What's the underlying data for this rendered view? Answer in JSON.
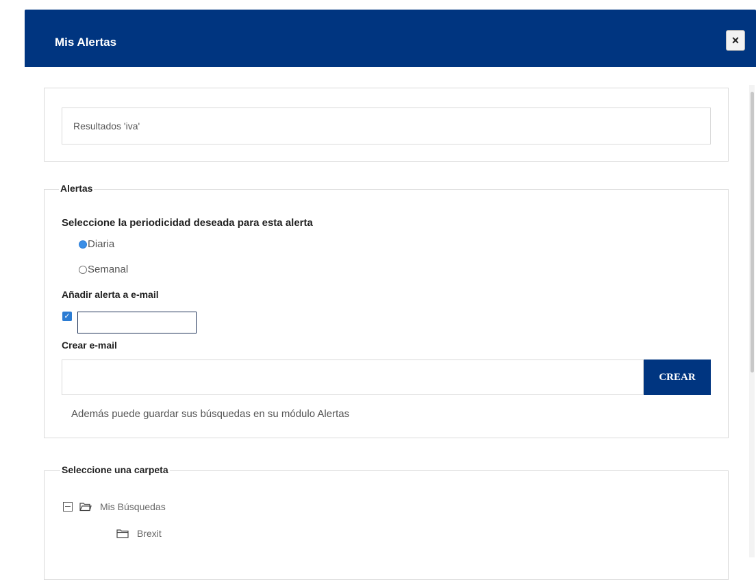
{
  "dialog": {
    "title": "Mis Alertas",
    "close_label": "×"
  },
  "results": {
    "text": "Resultados  'iva'"
  },
  "alerts": {
    "legend": "Alertas",
    "periodicity_label": "Seleccione la periodicidad deseada para esta alerta",
    "options": [
      {
        "label": "Diaria",
        "selected": true
      },
      {
        "label": "Semanal",
        "selected": false
      }
    ],
    "add_email_label": "Añadir alerta a e-mail",
    "add_email_checked": true,
    "create_email_label": "Crear e-mail",
    "create_email_value": "",
    "create_button": "CREAR",
    "info": "Además puede guardar sus búsquedas en su módulo Alertas"
  },
  "folders": {
    "legend": "Seleccione una carpeta",
    "items": [
      {
        "label": "Mis Búsquedas",
        "expanded": true,
        "level": 0
      },
      {
        "label": "Brexit",
        "level": 1
      }
    ]
  },
  "colors": {
    "header_bg": "#003580",
    "button_bg": "#003580",
    "radio_selected": "#3a8ee6"
  }
}
